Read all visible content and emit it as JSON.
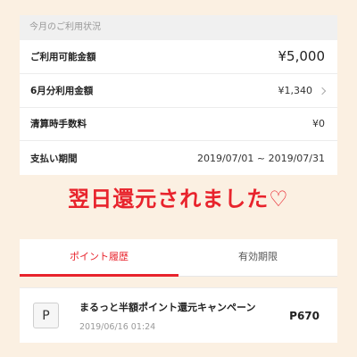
{
  "usage": {
    "header": "今月のご利用状況",
    "rows": [
      {
        "label": "ご利用可能金額",
        "value": "¥5,000"
      },
      {
        "label": "6月分利用金額",
        "value": "¥1,340"
      },
      {
        "label": "清算時手数料",
        "value": "¥0"
      },
      {
        "label": "支払い期間",
        "value": "2019/07/01 ~ 2019/07/31"
      }
    ]
  },
  "overlay_text": "翌日還元されました♡",
  "points": {
    "tabs": [
      "ポイント履歴",
      "有効期限"
    ],
    "entry": {
      "icon_letter": "P",
      "title": "まるっと半額ポイント還元キャンペーン",
      "date": "2019/06/16 01:24",
      "points": "P670"
    }
  },
  "colors": {
    "background": "#fbf0e2",
    "accent": "#e8232c"
  }
}
